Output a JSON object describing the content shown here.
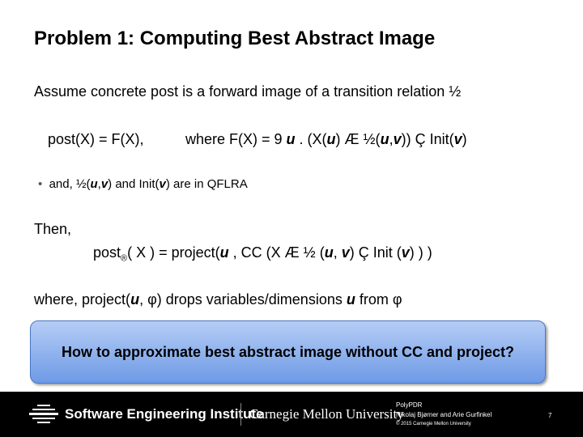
{
  "title": "Problem 1: Computing Best Abstract Image",
  "line1": "Assume concrete post is a forward image of a transition relation  ½",
  "line2": {
    "a": "post(X) = F(X),",
    "b": "where  F(X) = 9 ",
    "u1": "u",
    "c": " . (X(",
    "u2": "u",
    "d": ") Æ ½(",
    "u3": "u",
    "e": ",",
    "v1": "v",
    "f": ")) Ç Init(",
    "v2": "v",
    "g": ")"
  },
  "bullet": {
    "a": "and, ½(",
    "u": "u",
    "b": ",",
    "v": "v",
    "c": ") and Init(",
    "v2": "v",
    "d": ") are in QFLRA"
  },
  "then": "Then,",
  "post": {
    "a": "post",
    "sub": "®",
    "b": "( X ) = project(",
    "u": "u",
    "c": " , CC (X Æ ½ (",
    "u2": "u",
    "d": ", ",
    "v": "v",
    "e": ") Ç Init (",
    "v2": "v",
    "f": ") ) )"
  },
  "where": {
    "a": "where, project(",
    "u": "u",
    "b": ", φ) drops variables/dimensions ",
    "u2": "u",
    "c": " from φ"
  },
  "callout": "How to approximate best abstract image without CC and project?",
  "footer": {
    "sei": "Software Engineering Institute",
    "cmu": "Carnegie Mellon University",
    "talk": "PolyPDR",
    "authors": "Nikolaj Bjørner and Arie Gurfinkel",
    "copyright": "© 2015 Carnegie Mellon University",
    "page": "7"
  }
}
